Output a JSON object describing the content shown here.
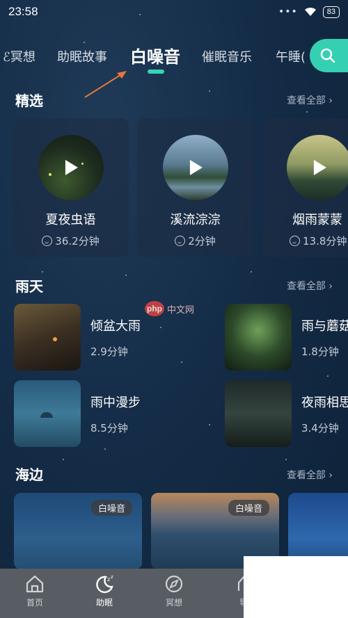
{
  "status_bar": {
    "time": "23:58",
    "dots": "•••",
    "battery": "83"
  },
  "tabs": [
    {
      "label": "冥想",
      "partial": "ೀ冥想"
    },
    {
      "label": "助眠故事"
    },
    {
      "label": "白噪音",
      "active": true
    },
    {
      "label": "催眠音乐"
    },
    {
      "label": "午睡"
    }
  ],
  "tabs_display": {
    "t0": "ℰ冥想",
    "t1": "助眠故事",
    "t2": "白噪音",
    "t3": "催眠音乐",
    "t4": "午睡("
  },
  "featured": {
    "title": "精选",
    "see_all": "查看全部 ›",
    "items": [
      {
        "title": "夏夜虫语",
        "duration": "36.2分钟"
      },
      {
        "title": "溪流淙淙",
        "duration": "2分钟"
      },
      {
        "title": "烟雨蒙蒙",
        "duration": "13.8分钟"
      }
    ]
  },
  "rain": {
    "title": "雨天",
    "see_all": "查看全部 ›",
    "items": [
      {
        "title": "倾盆大雨",
        "duration": "2.9分钟"
      },
      {
        "title": "雨与蘑菇",
        "duration": "1.8分钟"
      },
      {
        "title": "雨中漫步",
        "duration": "8.5分钟"
      },
      {
        "title": "夜雨相思",
        "duration": "3.4分钟"
      }
    ]
  },
  "beach": {
    "title": "海边",
    "see_all": "查看全部 ›",
    "tags": [
      "白噪音",
      "白噪音"
    ]
  },
  "bottom_nav": [
    {
      "label": "首页",
      "icon": "home-icon"
    },
    {
      "label": "助眠",
      "icon": "moon-zz-icon",
      "active": true
    },
    {
      "label": "冥想",
      "icon": "compass-icon"
    },
    {
      "label": "导",
      "icon": "guide-icon"
    }
  ],
  "watermark": {
    "badge": "php",
    "text": "中文网"
  },
  "colors": {
    "accent": "#35d6b3",
    "background": "#142c47",
    "nav_bg": "#585d63"
  }
}
